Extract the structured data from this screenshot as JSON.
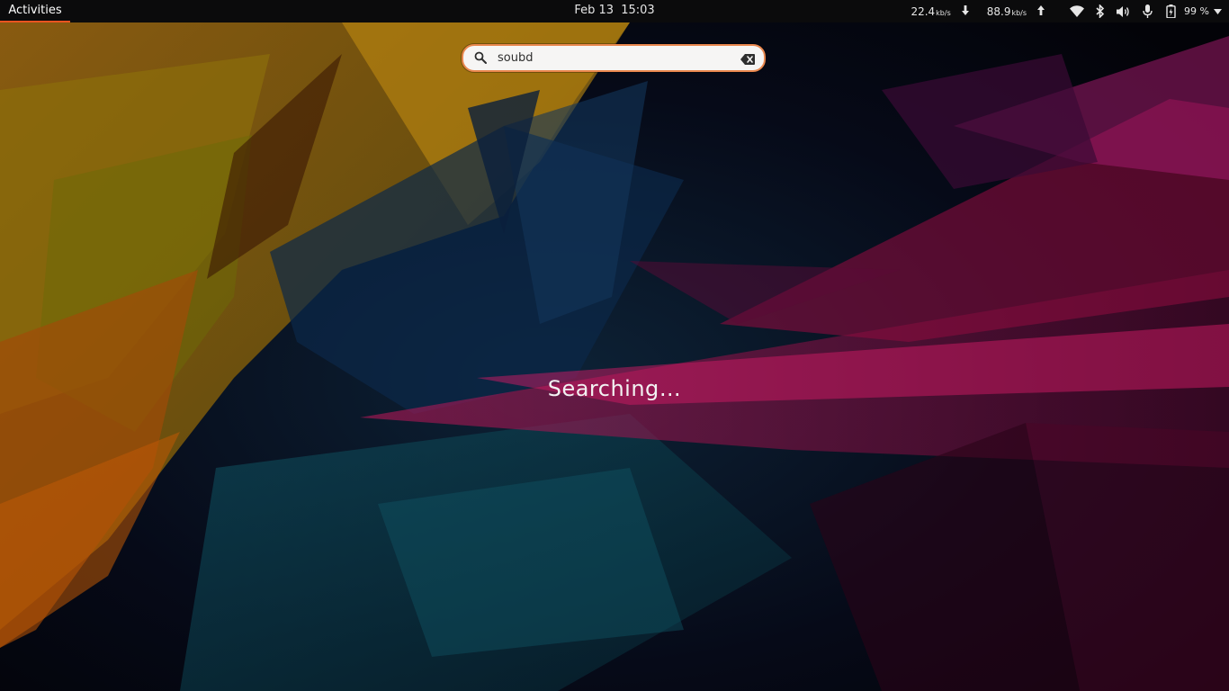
{
  "topbar": {
    "activities_label": "Activities",
    "date": "Feb 13",
    "time": "15:03",
    "net_down_value": "22.4",
    "net_down_unit": "kb/s",
    "net_up_value": "88.9",
    "net_up_unit": "kb/s",
    "battery_percent": "99 %",
    "icons": [
      "arrow-down-icon",
      "arrow-up-icon",
      "wifi-icon",
      "bluetooth-icon",
      "volume-icon",
      "microphone-icon",
      "battery-icon",
      "chevron-down-icon"
    ]
  },
  "search": {
    "value": "soubd",
    "icons": [
      "search-icon",
      "clear-icon"
    ]
  },
  "status": {
    "message": "Searching…"
  },
  "colors": {
    "accent": "#e95420",
    "search_border": "#e9874e",
    "topbar_bg": "#0b0b0c"
  }
}
